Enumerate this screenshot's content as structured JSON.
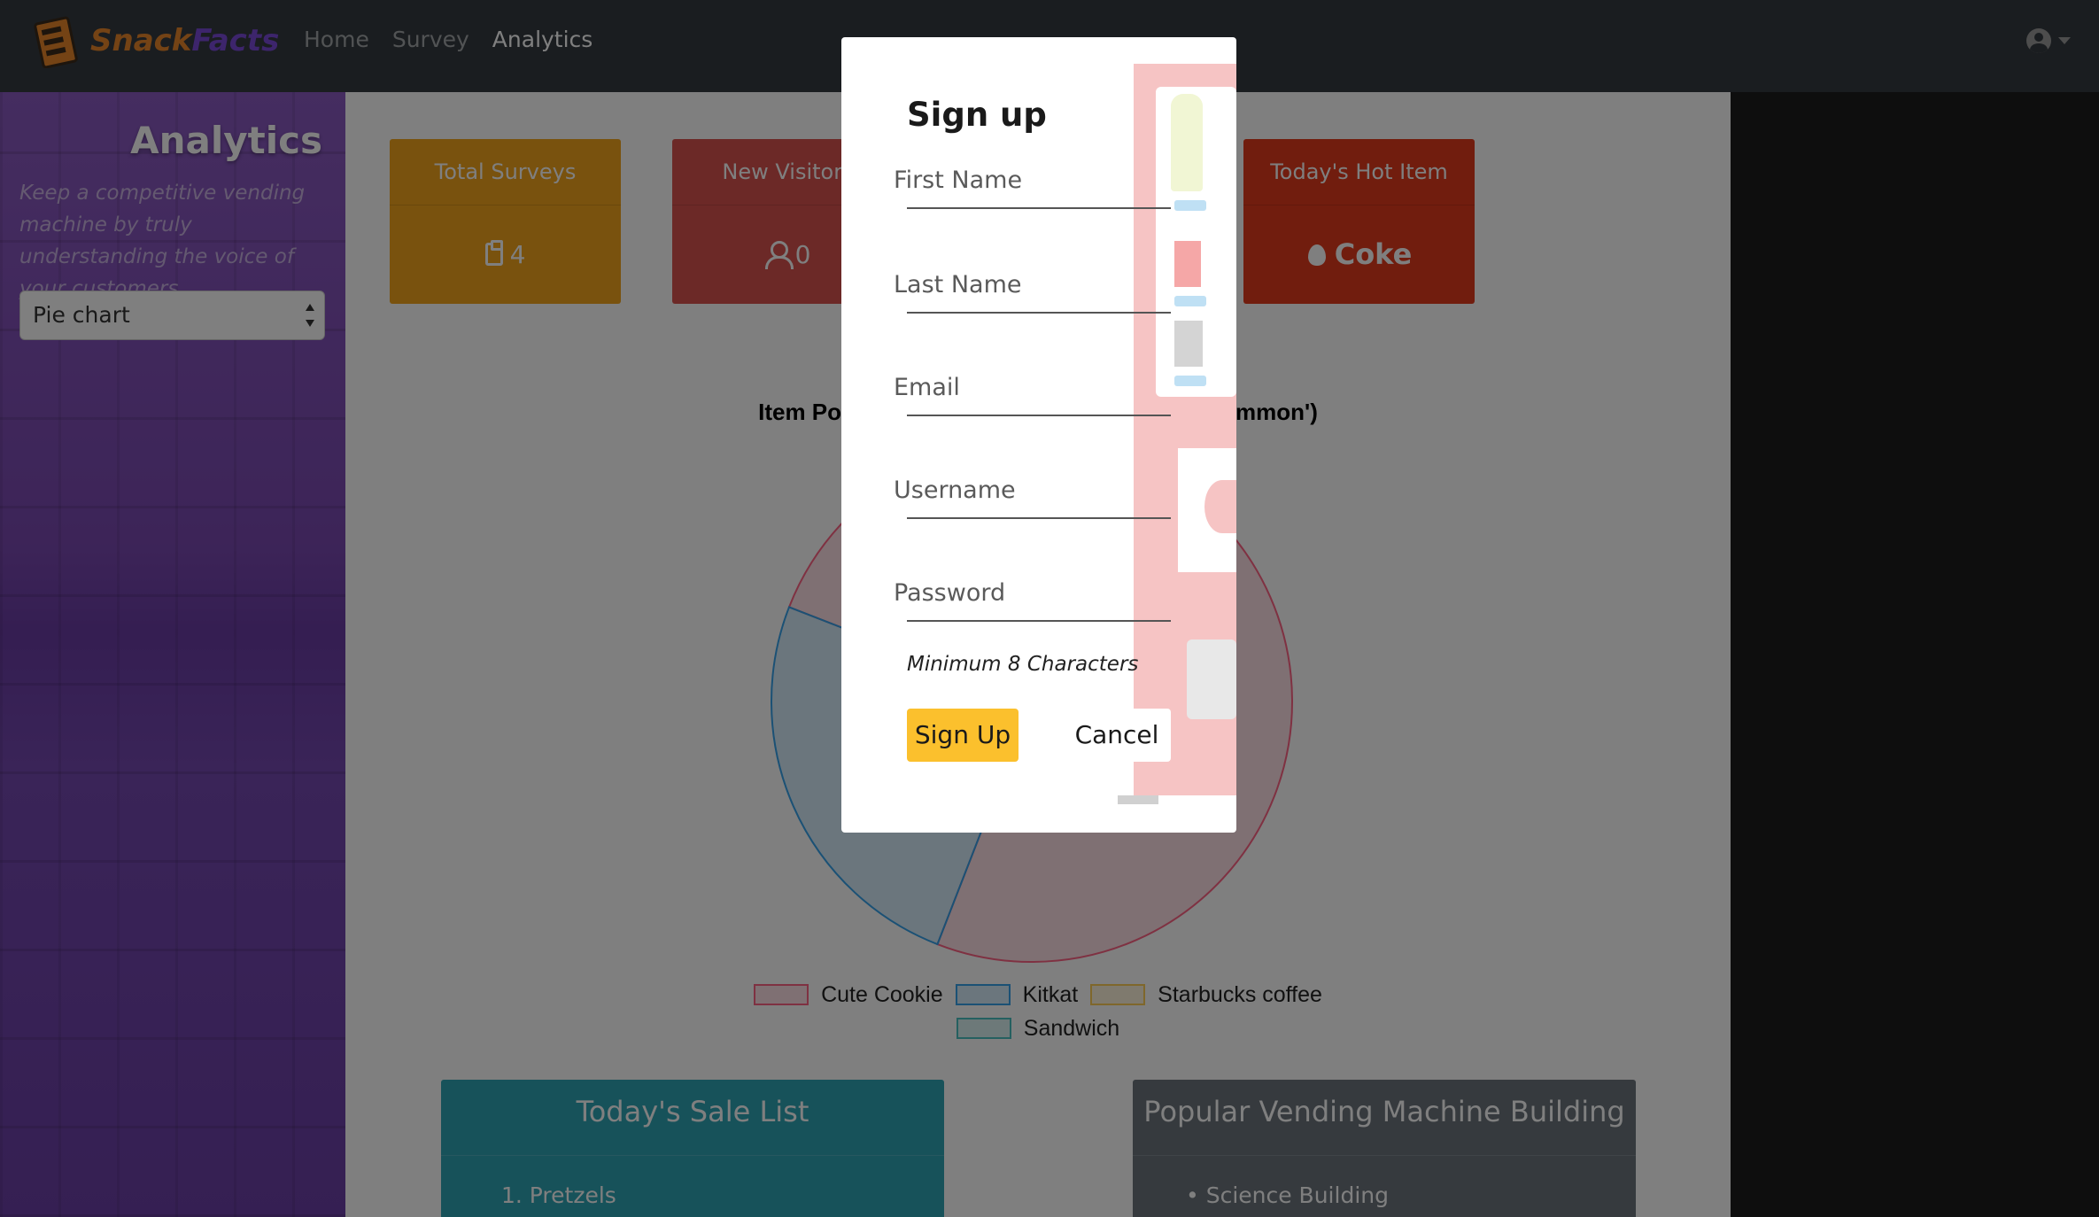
{
  "navbar": {
    "brand_part1": "Snack",
    "brand_part2": "Facts",
    "links": [
      "Home",
      "Survey",
      "Analytics"
    ],
    "active_link": "Analytics",
    "user_icon": "user-circle-icon"
  },
  "sidebar": {
    "title": "Analytics",
    "description": "Keep a competitive vending machine by truly understanding the voice of your customers.",
    "chart_type_selected": "Pie chart"
  },
  "stats": [
    {
      "label": "Total Surveys",
      "value": "4",
      "icon": "clipboard-icon",
      "color": "#f2a51c"
    },
    {
      "label": "New Visitors",
      "value": "0",
      "icon": "user-icon",
      "color": "#d9534f"
    },
    {
      "label": "Today's Hot Item",
      "value": "Coke",
      "icon": "fire-icon",
      "color": "#e23a1c"
    }
  ],
  "chart": {
    "title_left": "Item Po",
    "title_right": "mmon')"
  },
  "chart_data": {
    "type": "pie",
    "labels": [
      "Cute Cookie",
      "Kitkat",
      "Starbucks coffee",
      "Sandwich"
    ],
    "values": [
      3,
      1,
      0,
      0
    ],
    "colors": [
      "#ff6384",
      "#36a2eb",
      "#ffce56",
      "#4bc0c0"
    ],
    "legend_position": "bottom"
  },
  "panels": {
    "sale_list": {
      "title": "Today's Sale List",
      "items": [
        "1. Pretzels"
      ],
      "color": "#2fa4b5"
    },
    "popular_building": {
      "title": "Popular Vending Machine Building",
      "items": [
        "Science Building"
      ],
      "color": "#6c757d"
    }
  },
  "modal": {
    "title": "Sign up",
    "fields": {
      "first_name": {
        "label": "First Name",
        "value": ""
      },
      "last_name": {
        "label": "Last Name",
        "value": ""
      },
      "email": {
        "label": "Email",
        "value": ""
      },
      "username": {
        "label": "Username",
        "value": ""
      },
      "password": {
        "label": "Password",
        "value": ""
      }
    },
    "password_hint": "Minimum 8 Characters",
    "submit_label": "Sign Up",
    "cancel_label": "Cancel"
  }
}
